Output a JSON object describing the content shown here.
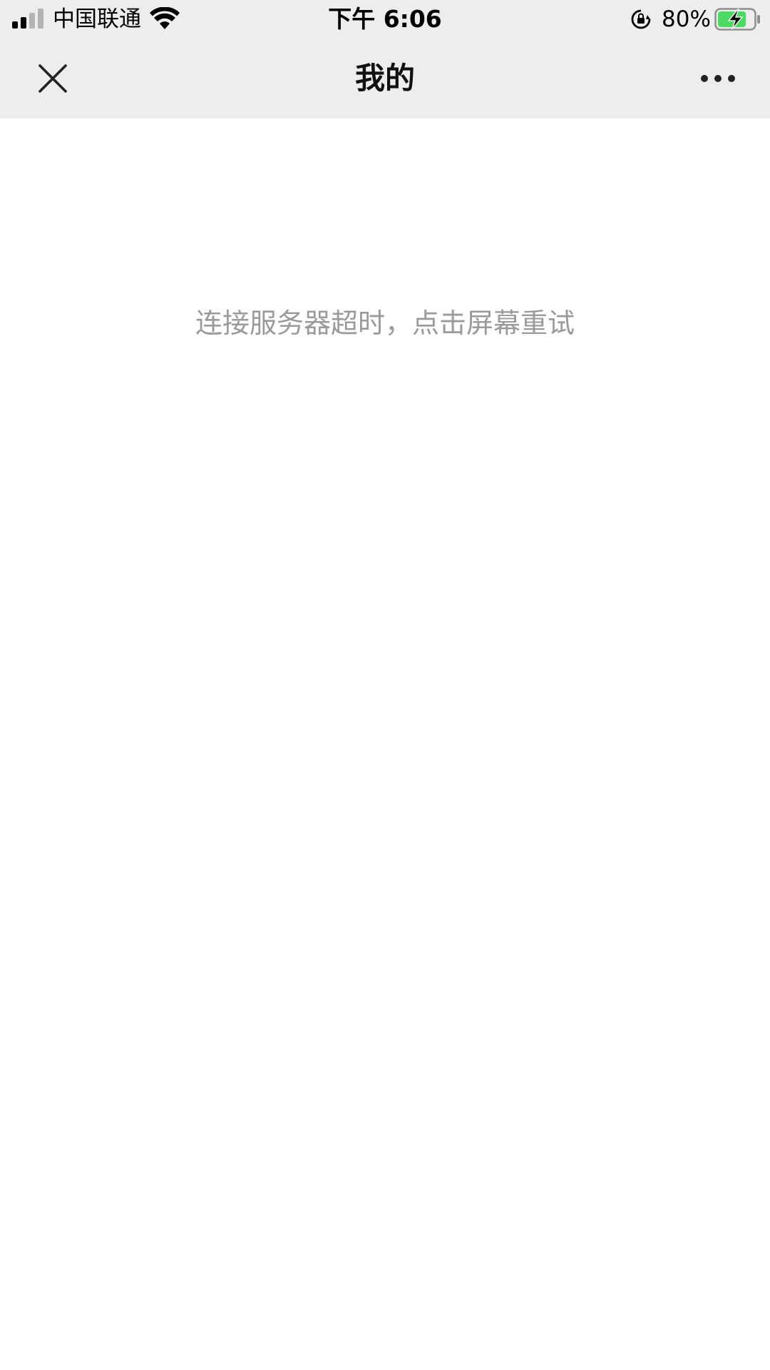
{
  "status_bar": {
    "carrier": "中国联通",
    "time": "下午 6:06",
    "battery_percent": "80%",
    "battery_level": 0.8,
    "battery_color": "#4cd964",
    "icons": [
      "signal-icon",
      "wifi-icon",
      "rotation-lock-icon",
      "battery-charging-icon"
    ]
  },
  "nav": {
    "title": "我的",
    "close_icon": "close-icon",
    "more_icon": "more-icon"
  },
  "content": {
    "message": "连接服务器超时，点击屏幕重试"
  },
  "colors": {
    "header_bg": "#ededed",
    "page_bg": "#ffffff",
    "message_text": "#9a9a9a"
  }
}
